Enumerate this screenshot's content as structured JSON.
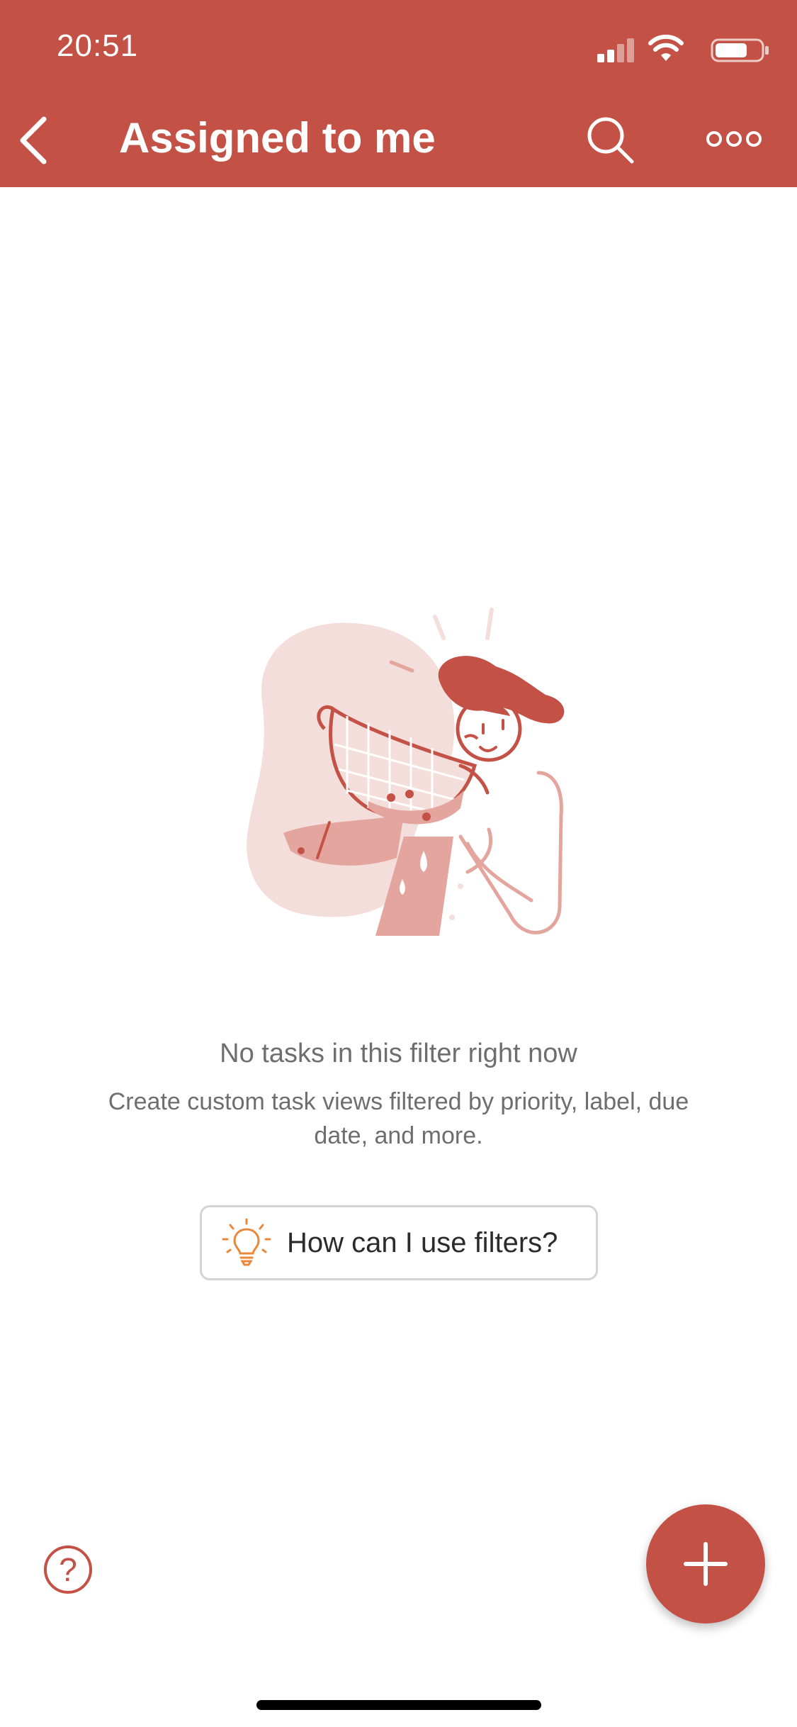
{
  "status_bar": {
    "time": "20:51"
  },
  "nav": {
    "title": "Assigned to me"
  },
  "empty_state": {
    "title": "No tasks in this filter right now",
    "description": "Create custom task views filtered by priority, label, due date, and more."
  },
  "help_button": {
    "label": "How can I use filters?",
    "icon": "lightbulb-icon"
  },
  "help_circle": {
    "label": "?"
  },
  "colors": {
    "brand": "#c45145",
    "illustration_light": "#f3dedb",
    "illustration_mid": "#e3a59d",
    "bulb_orange": "#e9883a",
    "text_secondary": "#6e6e6e"
  }
}
